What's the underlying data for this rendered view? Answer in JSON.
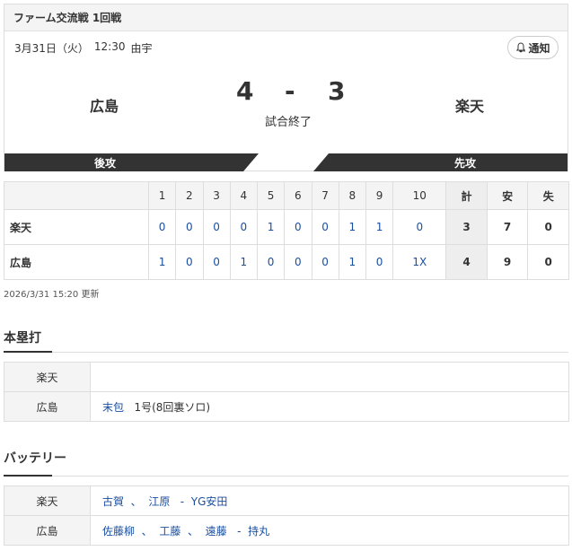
{
  "game": {
    "header": "ファーム交流戦 1回戦",
    "date": "3月31日（火）",
    "time": "12:30",
    "venue": "由宇",
    "notify_label": "通知",
    "home_team": "広島",
    "away_team": "楽天",
    "home_score": "4",
    "dash": "-",
    "away_score": "3",
    "status": "試合終了",
    "home_side": "後攻",
    "away_side": "先攻"
  },
  "linescore": {
    "innings": [
      "1",
      "2",
      "3",
      "4",
      "5",
      "6",
      "7",
      "8",
      "9",
      "10"
    ],
    "total_label": "計",
    "hits_label": "安",
    "errors_label": "失",
    "rows": [
      {
        "team": "楽天",
        "innings": [
          "0",
          "0",
          "0",
          "0",
          "1",
          "0",
          "0",
          "1",
          "1",
          "0"
        ],
        "runs": "3",
        "hits": "7",
        "errors": "0"
      },
      {
        "team": "広島",
        "innings": [
          "1",
          "0",
          "0",
          "1",
          "0",
          "0",
          "0",
          "1",
          "0",
          "1X"
        ],
        "runs": "4",
        "hits": "9",
        "errors": "0"
      }
    ]
  },
  "updated": "2026/3/31 15:20 更新",
  "homeruns": {
    "title": "本塁打",
    "rows": [
      {
        "team": "楽天",
        "player": "",
        "detail": ""
      },
      {
        "team": "広島",
        "player": "末包",
        "detail": "1号(8回裏ソロ)"
      }
    ]
  },
  "battery": {
    "title": "バッテリー",
    "rows": [
      {
        "team": "楽天",
        "pitchers": [
          "古賀",
          "江原"
        ],
        "catcher": "YG安田"
      },
      {
        "team": "広島",
        "pitchers": [
          "佐藤柳",
          "工藤",
          "遠藤"
        ],
        "catcher": "持丸"
      }
    ]
  },
  "colors": {
    "link": "#1a4fa0",
    "bar": "#333333"
  }
}
